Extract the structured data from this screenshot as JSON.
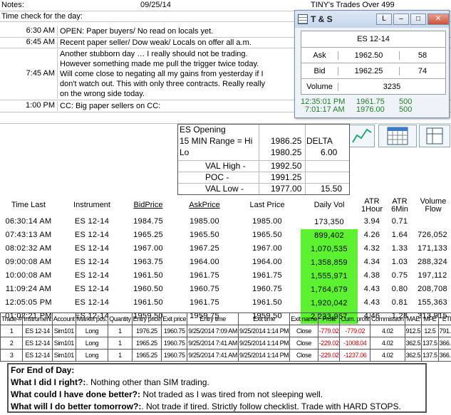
{
  "sheet": {
    "notes_label": "Notes:",
    "date": "09/25/14",
    "tiny_title": "TINY's Trades Over 499",
    "time_check_label": "Time check for the day:",
    "notes": [
      {
        "time": "6:30 AM",
        "text": "OPEN: Paper buyers/ No read on locals yet."
      },
      {
        "time": "6:45 AM",
        "text": "Recent paper seller/ Dow  weak/ Locals on offer all a.m."
      },
      {
        "time": "7:45 AM",
        "text": "Another stubborn day … I really should not be trading. However something made me pull the trigger twice today.  Will come close to negating all my gains from yesterday if I don't watch out.  This with only three contracts.  Really really on the wrong side today."
      },
      {
        "time": "1:00 PM",
        "text": "CC: Big paper sellers on CC:"
      }
    ]
  },
  "ts_window": {
    "title": "T & S",
    "btn_l": "L",
    "btn_min": "–",
    "btn_max": "□",
    "btn_close": "✕",
    "instrument": "ES 12-14",
    "ask_label": "Ask",
    "ask_price": "1962.50",
    "ask_size": "58",
    "bid_label": "Bid",
    "bid_price": "1962.25",
    "bid_size": "74",
    "volume_label": "Volume",
    "volume": "3235",
    "prints": [
      {
        "time": "12:35:01 PM",
        "price": "1961.75",
        "size": "500"
      },
      {
        "time": "7:01:17 AM",
        "price": "1976.00",
        "size": "500"
      }
    ]
  },
  "opening": {
    "title": "ES Opening",
    "range_label": "15 MIN Range = Hi",
    "hi": "1986.25",
    "delta_label": "DELTA",
    "lo_label": "Lo",
    "lo": "1980.25",
    "delta": "6.00",
    "val_high_label": "VAL High  -",
    "val_high": "1992.50",
    "poc_label": "POC  -",
    "poc": "1991.25",
    "val_low_label": "VAL Low  -",
    "val_low": "1977.00",
    "val_diff": "15.50"
  },
  "quotes": {
    "headers": {
      "time": "Time Last",
      "instrument": "Instrument",
      "bid": "BidPrice",
      "ask": "AskPrice",
      "last": "Last Price",
      "vol": "Daily Vol",
      "atr1": "ATR",
      "atr1b": "1Hour",
      "atr6": "ATR",
      "atr6b": "6Min",
      "vflow": "Volume",
      "vflowb": "Flow"
    },
    "rows": [
      {
        "time": "06:30:14 AM",
        "inst": "ES 12-14",
        "bid": "1984.75",
        "ask": "1985.00",
        "last": "1985.00",
        "vol": "173,350",
        "atr1": "3.94",
        "atr6": "0.71",
        "flow": "",
        "green": false
      },
      {
        "time": "07:43:13 AM",
        "inst": "ES 12-14",
        "bid": "1965.25",
        "ask": "1965.50",
        "last": "1965.50",
        "vol": "899,402",
        "atr1": "4.26",
        "atr6": "1.64",
        "flow": "726,052",
        "green": true
      },
      {
        "time": "08:02:32 AM",
        "inst": "ES 12-14",
        "bid": "1967.00",
        "ask": "1967.25",
        "last": "1967.00",
        "vol": "1,070,535",
        "atr1": "4.32",
        "atr6": "1.33",
        "flow": "171,133",
        "green": true
      },
      {
        "time": "09:00:08 AM",
        "inst": "ES 12-14",
        "bid": "1963.75",
        "ask": "1964.00",
        "last": "1964.00",
        "vol": "1,358,859",
        "atr1": "4.34",
        "atr6": "1.03",
        "flow": "288,324",
        "green": true
      },
      {
        "time": "10:00:08 AM",
        "inst": "ES 12-14",
        "bid": "1961.50",
        "ask": "1961.75",
        "last": "1961.75",
        "vol": "1,555,971",
        "atr1": "4.38",
        "atr6": "0.75",
        "flow": "197,112",
        "green": true
      },
      {
        "time": "11:09:24 AM",
        "inst": "ES 12-14",
        "bid": "1960.50",
        "ask": "1960.75",
        "last": "1960.75",
        "vol": "1,764,679",
        "atr1": "4.43",
        "atr6": "0.80",
        "flow": "208,708",
        "green": true
      },
      {
        "time": "12:05:05 PM",
        "inst": "ES 12-14",
        "bid": "1961.50",
        "ask": "1961.75",
        "last": "1961.50",
        "vol": "1,920,042",
        "atr1": "4.43",
        "atr6": "0.81",
        "flow": "155,363",
        "green": true
      },
      {
        "time": "01:02:21 PM",
        "inst": "ES 12-14",
        "bid": "1959.50",
        "ask": "1959.75",
        "last": "1959.50",
        "vol": "2,233,957",
        "atr1": "4.46",
        "atr6": "1.28",
        "flow": "313,915",
        "green": true
      }
    ]
  },
  "trades": {
    "headers": [
      "Trade-#",
      "Instrument",
      "Account",
      "Market pos.",
      "Quantity",
      "Entry price",
      "Exit price",
      "Entry time",
      "Exit time",
      "Exit name",
      "Profit",
      "Cum. profit",
      "Commission",
      "MAE",
      "MFE",
      "ETD"
    ],
    "rows": [
      [
        "1",
        "ES 12-14",
        "Sim101",
        "Long",
        "1",
        "1976.25",
        "1960.75",
        "9/25/2014 7:09 AM",
        "9/25/2014 1:14 PM",
        "Close",
        "-779.02",
        "-779.02",
        "4.02",
        "912.5",
        "12.5",
        "791.52"
      ],
      [
        "2",
        "ES 12-14",
        "Sim101",
        "Long",
        "1",
        "1965.25",
        "1960.75",
        "9/25/2014 7:41 AM",
        "9/25/2014 1:14 PM",
        "Close",
        "-229.02",
        "-1008.04",
        "4.02",
        "362.5",
        "137.5",
        "366.52"
      ],
      [
        "3",
        "ES 12-14",
        "Sim101",
        "Long",
        "1",
        "1965.25",
        "1960.75",
        "9/25/2014 7:41 AM",
        "9/25/2014 1:14 PM",
        "Close",
        "-229.02",
        "-1237.06",
        "4.02",
        "362.5",
        "137.5",
        "366.52"
      ]
    ]
  },
  "eod": {
    "title": "For End of Day:",
    "q1": "What I did I right?:",
    "a1": ". Nothing other than SIM trading.",
    "q2": "What could I have done better?:",
    "a2": " Not traded as I was tired from not sleeping well.",
    "q3": "What will I do better tomorrow?:",
    "a3": ". Not trade if tired.  Strictly follow checklist.  Trade with HARD STOPS."
  },
  "colors": {
    "volume_green": "#5cf231",
    "loss_red": "#d00000",
    "ts_green": "#208020"
  }
}
